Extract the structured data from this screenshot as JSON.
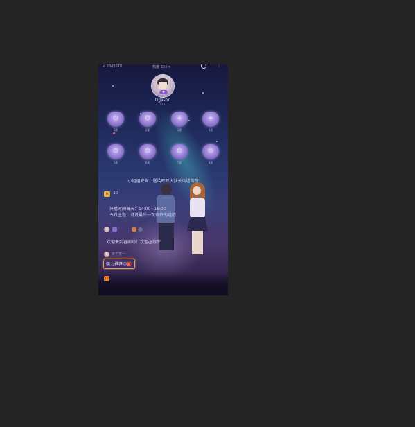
{
  "status_bar": {
    "left_text": "< 2345678",
    "hot_text": "热度 234 >",
    "right_icons": [
      "circle-icon",
      "more-icon"
    ]
  },
  "host": {
    "name": "OJJason",
    "sub": "ID 1",
    "badge": "♥"
  },
  "seats": [
    {
      "glyph": "⏻",
      "label": "1麦"
    },
    {
      "glyph": "⏻",
      "label": "2麦"
    },
    {
      "glyph": "+",
      "label": "3麦"
    },
    {
      "glyph": "+",
      "label": "4麦"
    },
    {
      "glyph": "⏻",
      "label": "5麦"
    },
    {
      "glyph": "⏻",
      "label": "6麦"
    },
    {
      "glyph": "⏻",
      "label": "7麦"
    },
    {
      "glyph": "⏻",
      "label": "8麦"
    }
  ],
  "notice": "小姐姐安安…送给旺旺大队长动墙首符",
  "rank": {
    "icon": "♛",
    "text": "10"
  },
  "messages": {
    "room_rule_1": "开播时间每天：14:00~16:00",
    "room_rule_2": "今日主题：说说最后一次告白的经历",
    "user1_badges": "",
    "welcome": "欢迎来到春剧场！欢迎@苏菲",
    "user2_name": "天下第一",
    "user2_msg": "强力推荐😊🎒"
  },
  "colors": {
    "background": "#242424",
    "accent": "#8c5bd6",
    "pill_border": "#e6a24a"
  }
}
